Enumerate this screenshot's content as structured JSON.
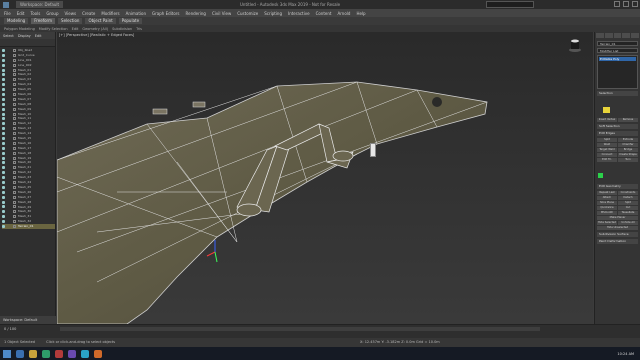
{
  "titlebar": {
    "workspace": "Workspace: Default",
    "title": "Untitled - Autodesk 3ds Max 2019 - Not for Resale",
    "search_placeholder": "Search"
  },
  "menus": [
    "File",
    "Edit",
    "Tools",
    "Group",
    "Views",
    "Create",
    "Modifiers",
    "Animation",
    "Graph Editors",
    "Rendering",
    "Civil View",
    "Customize",
    "Scripting",
    "Interactive",
    "Content",
    "Arnold",
    "Help"
  ],
  "ribbon_tabs": [
    "Modeling",
    "Freeform",
    "Selection",
    "Object Paint",
    "Populate"
  ],
  "subribbon": [
    "Polygon Modeling",
    "Modify Selection",
    "Edit",
    "Geometry (All)",
    "Subdivision",
    "Tris"
  ],
  "scene_explorer": {
    "tabs": [
      "Select",
      "Display",
      "Edit"
    ],
    "items": [
      "Obj_Road",
      "Grid_Curve",
      "Line_001",
      "Line_002",
      "Mesh_01",
      "Mesh_02",
      "Mesh_03",
      "Mesh_04",
      "Mesh_05",
      "Mesh_06",
      "Mesh_07",
      "Mesh_08",
      "Mesh_09",
      "Mesh_10",
      "Mesh_11",
      "Mesh_12",
      "Mesh_13",
      "Mesh_14",
      "Mesh_15",
      "Mesh_16",
      "Mesh_17",
      "Mesh_18",
      "Mesh_19",
      "Mesh_20",
      "Mesh_21",
      "Mesh_22",
      "Mesh_23",
      "Mesh_24",
      "Mesh_25",
      "Mesh_26",
      "Mesh_27",
      "Mesh_28",
      "Mesh_29",
      "Mesh_30",
      "Mesh_31",
      "Mesh_32",
      "Terrain_01"
    ],
    "selected_index": 36,
    "workspace_footer": "Workspace: Default"
  },
  "viewport": {
    "label": "[+] [Perspective] [Realistic + Edged Faces]"
  },
  "command_panel": {
    "object_name": "Terrain_01",
    "modifier_list_label": "Modifier List",
    "stack_item": "Editable Poly",
    "sections": [
      "Selection",
      "Soft Selection",
      "Edit Edges",
      "Edit Geometry",
      "Subdivision Surface",
      "Paint Deformation"
    ],
    "buttons": [
      "Insert Vertex",
      "Remove",
      "Split",
      "Extrude",
      "Weld",
      "Chamfer",
      "Target Weld",
      "Bridge",
      "Connect",
      "Create Shape",
      "Edit Tri.",
      "Turn",
      "Repeat Last",
      "Constraints",
      "Attach",
      "Detach",
      "Slice Plane",
      "Split",
      "Quickslice",
      "Cut",
      "MSmooth",
      "Tessellate",
      "Make Planar",
      "Hide Selected",
      "Unhide All",
      "Hide Unselected"
    ],
    "swatch_color": "#e8d43a",
    "green_color": "#2bd14a"
  },
  "timeline": {
    "frame_text": "0 / 100"
  },
  "status": {
    "message": "1 Object Selected",
    "hint": "Click or click-and-drag to select objects",
    "coords": "X: 12.457m   Y: -3.182m   Z: 0.0m   Grid = 10.0m"
  },
  "taskbar": {
    "clock": "10:24 AM"
  }
}
